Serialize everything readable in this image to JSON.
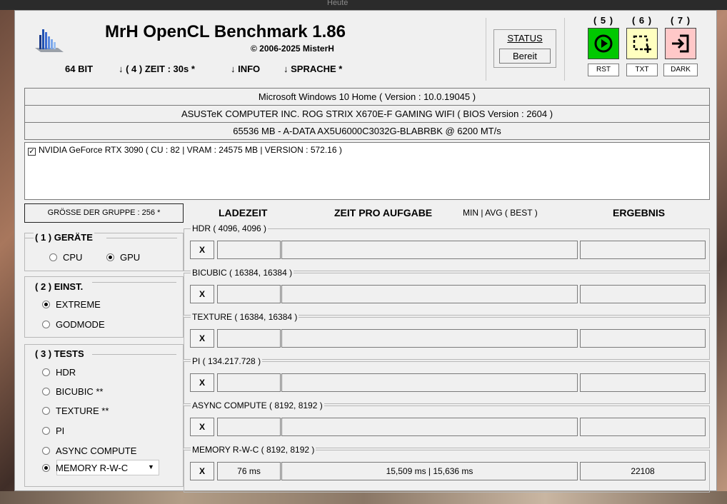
{
  "background": {
    "taskbar_text": "Heute"
  },
  "header": {
    "title": "MrH OpenCL Benchmark 1.86",
    "copyright": "© 2006-2025 MisterH",
    "bitness": "64 BIT",
    "menu_zeit": "↓ ( 4 ) ZEIT : 30s *",
    "menu_info": "↓ INFO",
    "menu_sprache": "↓ SPRACHE *"
  },
  "status": {
    "title": "STATUS",
    "value": "Bereit"
  },
  "actions": [
    {
      "number": "( 5 )",
      "icon": "play-icon",
      "color": "#00c800",
      "label": "RST"
    },
    {
      "number": "( 6 )",
      "icon": "selection-icon",
      "color": "#ffffc0",
      "label": "TXT"
    },
    {
      "number": "( 7 )",
      "icon": "exit-icon",
      "color": "#ffc8c8",
      "label": "DARK"
    }
  ],
  "system": {
    "os": "Microsoft Windows 10 Home ( Version : 10.0.19045 )",
    "board": "ASUSTeK COMPUTER INC. ROG STRIX X670E-F GAMING WIFI ( BIOS Version : 2604 )",
    "memory": "65536 MB - A-DATA AX5U6000C3032G-BLABRBK      @ 6200 MT/s"
  },
  "gpu": {
    "checked": true,
    "label": "NVIDIA GeForce RTX 3090 ( CU : 82 | VRAM : 24575 MB | VERSION : 572.16 )"
  },
  "group_size": "GRÖSSE DER GRUPPE : 256 *",
  "columns": {
    "ladezeit": "LADEZEIT",
    "zeit": "ZEIT PRO AUFGABE",
    "minavg": "MIN | AVG ( BEST )",
    "ergebnis": "ERGEBNIS"
  },
  "devices": {
    "title": "( 1 ) GERÄTE",
    "options": [
      {
        "label": "CPU",
        "selected": false
      },
      {
        "label": "GPU",
        "selected": true
      }
    ]
  },
  "settings": {
    "title": "( 2 ) EINST.",
    "options": [
      {
        "label": "EXTREME",
        "selected": true
      },
      {
        "label": "GODMODE",
        "selected": false
      }
    ]
  },
  "tests": {
    "title": "( 3 ) TESTS",
    "options": [
      {
        "label": "HDR",
        "selected": false
      },
      {
        "label": "BICUBIC **",
        "selected": false
      },
      {
        "label": "TEXTURE **",
        "selected": false
      },
      {
        "label": "PI",
        "selected": false
      },
      {
        "label": "ASYNC COMPUTE",
        "selected": false
      },
      {
        "label": "MEMORY R-W-C",
        "selected": true
      }
    ]
  },
  "results": [
    {
      "name": "HDR ( 4096, 4096 )",
      "x": "X",
      "load": "",
      "time": "",
      "result": ""
    },
    {
      "name": "BICUBIC ( 16384, 16384 )",
      "x": "X",
      "load": "",
      "time": "",
      "result": ""
    },
    {
      "name": "TEXTURE ( 16384, 16384 )",
      "x": "X",
      "load": "",
      "time": "",
      "result": ""
    },
    {
      "name": "PI ( 134.217.728 )",
      "x": "X",
      "load": "",
      "time": "",
      "result": ""
    },
    {
      "name": "ASYNC COMPUTE ( 8192, 8192 )",
      "x": "X",
      "load": "",
      "time": "",
      "result": ""
    },
    {
      "name": "MEMORY R-W-C ( 8192, 8192 )",
      "x": "X",
      "load": "76 ms",
      "time": "15,509 ms | 15,636 ms",
      "result": "22108"
    }
  ]
}
